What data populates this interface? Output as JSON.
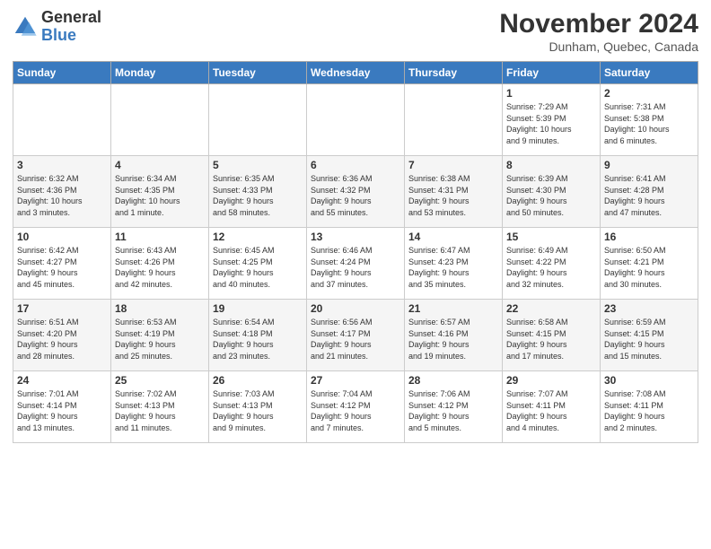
{
  "header": {
    "logo_general": "General",
    "logo_blue": "Blue",
    "month_title": "November 2024",
    "location": "Dunham, Quebec, Canada"
  },
  "weekdays": [
    "Sunday",
    "Monday",
    "Tuesday",
    "Wednesday",
    "Thursday",
    "Friday",
    "Saturday"
  ],
  "weeks": [
    [
      {
        "day": "",
        "info": ""
      },
      {
        "day": "",
        "info": ""
      },
      {
        "day": "",
        "info": ""
      },
      {
        "day": "",
        "info": ""
      },
      {
        "day": "",
        "info": ""
      },
      {
        "day": "1",
        "info": "Sunrise: 7:29 AM\nSunset: 5:39 PM\nDaylight: 10 hours\nand 9 minutes."
      },
      {
        "day": "2",
        "info": "Sunrise: 7:31 AM\nSunset: 5:38 PM\nDaylight: 10 hours\nand 6 minutes."
      }
    ],
    [
      {
        "day": "3",
        "info": "Sunrise: 6:32 AM\nSunset: 4:36 PM\nDaylight: 10 hours\nand 3 minutes."
      },
      {
        "day": "4",
        "info": "Sunrise: 6:34 AM\nSunset: 4:35 PM\nDaylight: 10 hours\nand 1 minute."
      },
      {
        "day": "5",
        "info": "Sunrise: 6:35 AM\nSunset: 4:33 PM\nDaylight: 9 hours\nand 58 minutes."
      },
      {
        "day": "6",
        "info": "Sunrise: 6:36 AM\nSunset: 4:32 PM\nDaylight: 9 hours\nand 55 minutes."
      },
      {
        "day": "7",
        "info": "Sunrise: 6:38 AM\nSunset: 4:31 PM\nDaylight: 9 hours\nand 53 minutes."
      },
      {
        "day": "8",
        "info": "Sunrise: 6:39 AM\nSunset: 4:30 PM\nDaylight: 9 hours\nand 50 minutes."
      },
      {
        "day": "9",
        "info": "Sunrise: 6:41 AM\nSunset: 4:28 PM\nDaylight: 9 hours\nand 47 minutes."
      }
    ],
    [
      {
        "day": "10",
        "info": "Sunrise: 6:42 AM\nSunset: 4:27 PM\nDaylight: 9 hours\nand 45 minutes."
      },
      {
        "day": "11",
        "info": "Sunrise: 6:43 AM\nSunset: 4:26 PM\nDaylight: 9 hours\nand 42 minutes."
      },
      {
        "day": "12",
        "info": "Sunrise: 6:45 AM\nSunset: 4:25 PM\nDaylight: 9 hours\nand 40 minutes."
      },
      {
        "day": "13",
        "info": "Sunrise: 6:46 AM\nSunset: 4:24 PM\nDaylight: 9 hours\nand 37 minutes."
      },
      {
        "day": "14",
        "info": "Sunrise: 6:47 AM\nSunset: 4:23 PM\nDaylight: 9 hours\nand 35 minutes."
      },
      {
        "day": "15",
        "info": "Sunrise: 6:49 AM\nSunset: 4:22 PM\nDaylight: 9 hours\nand 32 minutes."
      },
      {
        "day": "16",
        "info": "Sunrise: 6:50 AM\nSunset: 4:21 PM\nDaylight: 9 hours\nand 30 minutes."
      }
    ],
    [
      {
        "day": "17",
        "info": "Sunrise: 6:51 AM\nSunset: 4:20 PM\nDaylight: 9 hours\nand 28 minutes."
      },
      {
        "day": "18",
        "info": "Sunrise: 6:53 AM\nSunset: 4:19 PM\nDaylight: 9 hours\nand 25 minutes."
      },
      {
        "day": "19",
        "info": "Sunrise: 6:54 AM\nSunset: 4:18 PM\nDaylight: 9 hours\nand 23 minutes."
      },
      {
        "day": "20",
        "info": "Sunrise: 6:56 AM\nSunset: 4:17 PM\nDaylight: 9 hours\nand 21 minutes."
      },
      {
        "day": "21",
        "info": "Sunrise: 6:57 AM\nSunset: 4:16 PM\nDaylight: 9 hours\nand 19 minutes."
      },
      {
        "day": "22",
        "info": "Sunrise: 6:58 AM\nSunset: 4:15 PM\nDaylight: 9 hours\nand 17 minutes."
      },
      {
        "day": "23",
        "info": "Sunrise: 6:59 AM\nSunset: 4:15 PM\nDaylight: 9 hours\nand 15 minutes."
      }
    ],
    [
      {
        "day": "24",
        "info": "Sunrise: 7:01 AM\nSunset: 4:14 PM\nDaylight: 9 hours\nand 13 minutes."
      },
      {
        "day": "25",
        "info": "Sunrise: 7:02 AM\nSunset: 4:13 PM\nDaylight: 9 hours\nand 11 minutes."
      },
      {
        "day": "26",
        "info": "Sunrise: 7:03 AM\nSunset: 4:13 PM\nDaylight: 9 hours\nand 9 minutes."
      },
      {
        "day": "27",
        "info": "Sunrise: 7:04 AM\nSunset: 4:12 PM\nDaylight: 9 hours\nand 7 minutes."
      },
      {
        "day": "28",
        "info": "Sunrise: 7:06 AM\nSunset: 4:12 PM\nDaylight: 9 hours\nand 5 minutes."
      },
      {
        "day": "29",
        "info": "Sunrise: 7:07 AM\nSunset: 4:11 PM\nDaylight: 9 hours\nand 4 minutes."
      },
      {
        "day": "30",
        "info": "Sunrise: 7:08 AM\nSunset: 4:11 PM\nDaylight: 9 hours\nand 2 minutes."
      }
    ]
  ]
}
